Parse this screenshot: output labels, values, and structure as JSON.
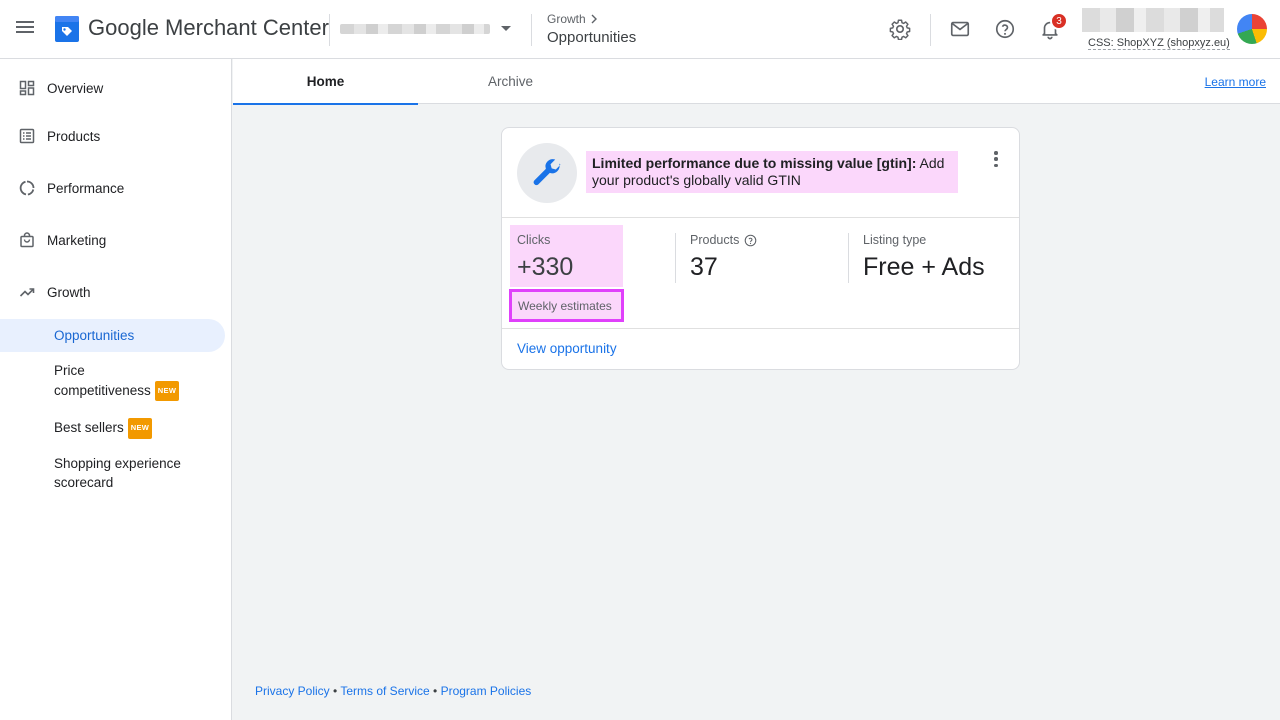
{
  "header": {
    "app_name": "Google Merchant Center",
    "breadcrumb_parent": "Growth",
    "breadcrumb_current": "Opportunities",
    "notification_count": "3",
    "css_label": "CSS: ShopXYZ (shopxyz.eu)"
  },
  "sidebar": {
    "items": [
      {
        "label": "Overview",
        "icon": "dashboard-icon"
      },
      {
        "label": "Products",
        "icon": "list-icon"
      },
      {
        "label": "Performance",
        "icon": "donut-icon"
      },
      {
        "label": "Marketing",
        "icon": "bag-icon"
      },
      {
        "label": "Growth",
        "icon": "trending-up-icon"
      }
    ],
    "growth_children": {
      "opportunities": "Opportunities",
      "price_comp_line1": "Price",
      "price_comp_line2": "competitiveness",
      "best_sellers": "Best sellers",
      "shopping_line1": "Shopping experience",
      "shopping_line2": "scorecard"
    },
    "new_tag": "NEW"
  },
  "tabs": {
    "home": "Home",
    "archive": "Archive",
    "learn_more": "Learn more"
  },
  "card": {
    "title_bold": "Limited performance due to missing value [gtin]:",
    "title_rest": " Add your product's globally valid GTIN",
    "metrics": {
      "clicks_label": "Clicks",
      "clicks_value": "+330",
      "products_label": "Products",
      "products_value": "37",
      "listing_label": "Listing type",
      "listing_value": "Free + Ads"
    },
    "weekly_estimates": "Weekly estimates",
    "view_opportunity": "View opportunity"
  },
  "footer": {
    "privacy": "Privacy Policy",
    "terms": "Terms of Service",
    "program": "Program Policies",
    "separator": " • "
  },
  "colors": {
    "accent": "#1a73e8",
    "highlight": "#fbd7fb",
    "highlight_border": "#e040fb",
    "new_tag": "#f29900",
    "badge": "#d93025"
  }
}
